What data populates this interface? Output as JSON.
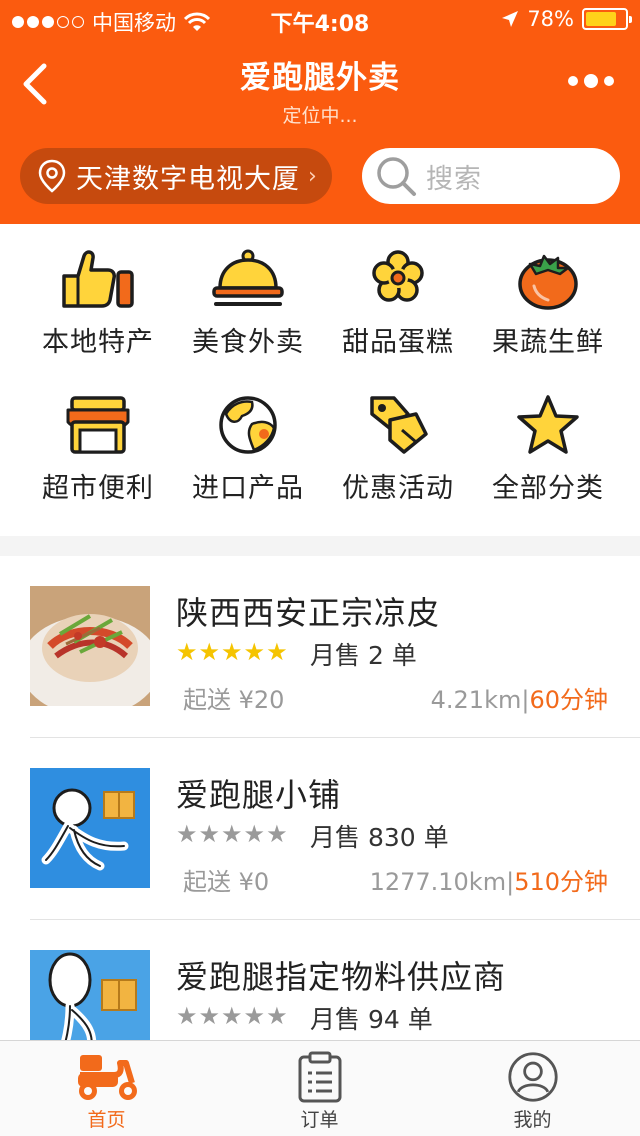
{
  "status_bar": {
    "carrier": "中国移动",
    "time": "下午4:08",
    "battery": "78%",
    "battery_level": 0.78
  },
  "nav": {
    "title": "爱跑腿外卖",
    "subtitle": "定位中..."
  },
  "location": {
    "text": "天津数字电视大厦"
  },
  "search": {
    "placeholder": "搜索"
  },
  "categories": [
    {
      "label": "本地特产",
      "icon": "thumbs-up-icon"
    },
    {
      "label": "美食外卖",
      "icon": "food-cloche-icon"
    },
    {
      "label": "甜品蛋糕",
      "icon": "flower-icon"
    },
    {
      "label": "果蔬生鲜",
      "icon": "tomato-icon"
    },
    {
      "label": "超市便利",
      "icon": "store-icon"
    },
    {
      "label": "进口产品",
      "icon": "globe-icon"
    },
    {
      "label": "优惠活动",
      "icon": "tags-icon"
    },
    {
      "label": "全部分类",
      "icon": "star-icon"
    }
  ],
  "shops": [
    {
      "name": "陕西西安正宗凉皮",
      "stars": "★★★★★",
      "rating": 5,
      "sales": "月售 2 单",
      "min_order": "起送 ¥20",
      "distance": "4.21km",
      "sep": "|",
      "eta": "60分钟"
    },
    {
      "name": "爱跑腿小铺",
      "stars": "★★★★★",
      "rating": 0,
      "sales": "月售 830 单",
      "min_order": "起送 ¥0",
      "distance": "1277.10km",
      "sep": "|",
      "eta": "510分钟"
    },
    {
      "name": "爱跑腿指定物料供应商",
      "stars": "★★★★★",
      "rating": 0,
      "sales": "月售 94 单",
      "min_order": "",
      "distance": "",
      "sep": "",
      "eta": ""
    }
  ],
  "tabs": [
    {
      "label": "首页",
      "icon": "scooter-icon",
      "active": true
    },
    {
      "label": "订单",
      "icon": "clipboard-icon",
      "active": false
    },
    {
      "label": "我的",
      "icon": "user-icon",
      "active": false
    }
  ],
  "colors": {
    "primary": "#fb5b0f",
    "accent_text": "#f26a1b",
    "star_active": "#f5c400",
    "star_inactive": "#9a9a9a"
  }
}
